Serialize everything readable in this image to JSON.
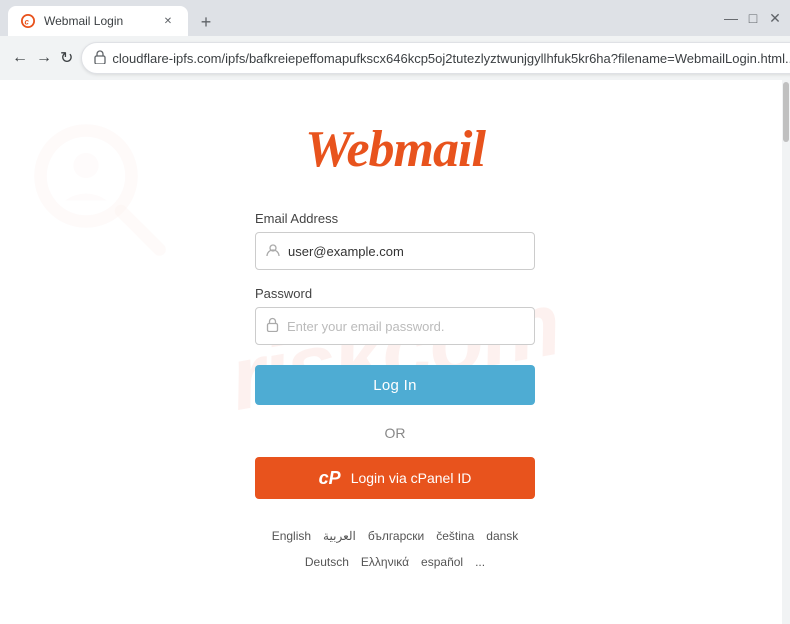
{
  "browser": {
    "tab": {
      "title": "Webmail Login",
      "favicon": "mail-icon"
    },
    "new_tab_label": "+",
    "window_controls": {
      "minimize": "—",
      "maximize": "□",
      "close": "✕"
    },
    "address_bar": {
      "url": "cloudflare-ipfs.com/ipfs/bafkreiepeffomapufkscx646kcp5oj2tutezlyztwunjgyllhfuk5kr6ha?filename=WebmailLogin.html...",
      "lock_icon": "🔒"
    },
    "nav": {
      "back": "←",
      "forward": "→",
      "refresh": "↻"
    }
  },
  "page": {
    "logo": "Webmail",
    "form": {
      "email_label": "Email Address",
      "email_placeholder": "user@example.com",
      "password_label": "Password",
      "password_placeholder": "Enter your email password.",
      "login_button": "Log In",
      "or_text": "OR",
      "cpanel_button": "Login via cPanel ID",
      "cpanel_logo_text": "cP"
    },
    "languages": [
      "English",
      "العربية",
      "български",
      "čeština",
      "dansk",
      "Deutsch",
      "Ελληνικά",
      "español",
      "..."
    ],
    "watermark": "riskcom"
  }
}
